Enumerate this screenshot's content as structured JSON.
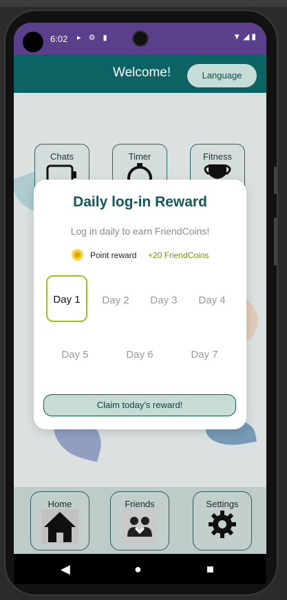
{
  "status": {
    "time": "6:02",
    "left_icons": "▸ ⚙ ▮",
    "right_icons": "▼◢▮"
  },
  "appbar": {
    "title": "Welcome!",
    "language_label": "Language"
  },
  "tiles": [
    {
      "label": "Chats",
      "icon": "chat-icon"
    },
    {
      "label": "Timer",
      "icon": "timer-icon"
    },
    {
      "label": "Fitness",
      "icon": "trophy-icon"
    }
  ],
  "bottom_nav": [
    {
      "label": "Home",
      "icon": "home-icon"
    },
    {
      "label": "Friends",
      "icon": "friends-icon"
    },
    {
      "label": "Settings",
      "icon": "gear-icon"
    }
  ],
  "dialog": {
    "title": "Daily log-in Reward",
    "subtitle": "Log in daily to earn FriendCoins!",
    "point_label": "Point reward",
    "point_value": "+20 FriendCoins",
    "days": [
      "Day 1",
      "Day 2",
      "Day 3",
      "Day 4",
      "Day 5",
      "Day 6",
      "Day 7"
    ],
    "active_day": 1,
    "claim_label": "Claim today's reward!"
  },
  "system_nav": {
    "back": "◀",
    "home": "●",
    "recents": "■"
  },
  "colors": {
    "accent": "#0d6263",
    "status_bar": "#5b3f8c",
    "active_day_border": "#9bc31e",
    "coin": "#f2c21b"
  }
}
